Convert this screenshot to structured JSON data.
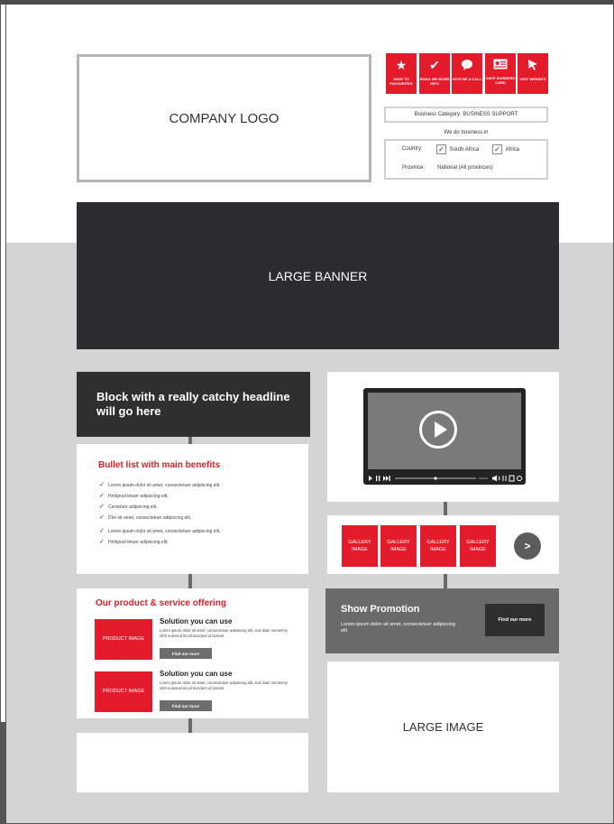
{
  "logo": "COMPANY LOGO",
  "actions": [
    {
      "label": "SAVE TO FAVOURITES",
      "icon": "star-icon"
    },
    {
      "label": "EMAIL ME MORE INFO",
      "icon": "checkmark-icon"
    },
    {
      "label": "GIVE ME A CALL",
      "icon": "speech-bubble-icon"
    },
    {
      "label": "SAVE BUSINESS CARD",
      "icon": "business-card-icon"
    },
    {
      "label": "VISIT WEBSITE",
      "icon": "cursor-icon"
    }
  ],
  "business_category": "Business Category: BUSINESS SUPPORT",
  "we_do_business": "We do business in",
  "country": {
    "label": "Country:",
    "options": [
      "South Africa",
      "Africa"
    ]
  },
  "province": {
    "label": "Province:",
    "value": "National (All provinces)"
  },
  "banner": "LARGE BANNER",
  "headline": "Block with a really catchy headline will go here",
  "bullets": {
    "title": "Bullet list with main benefits",
    "items": [
      "Lorem ipsum dolor sit amet, consectetuer adipiscing elit,",
      "Hmbjnsd tetuer adipiscing elit,",
      "Cectetuer adipiscing elit,",
      "Dlor sit amet, consectetuer adipiscing elit,",
      "Lorem ipsum dolor sit amet, consectetuer adipiscing elit,",
      "Hmbjnsd tetuer adipiscing elit,"
    ]
  },
  "products": {
    "title": "Our product & service offering",
    "items": [
      {
        "image": "PRODUCT IMAGE",
        "title": "Solution you can use",
        "desc": "Lorem ipsum dolor sit amet, consectetuer adipiscing elit, sed diam nonummy nibh euismod tincid tincidunt ut laoreet .",
        "button": "Find our more"
      },
      {
        "image": "PRODUCT IMAGE",
        "title": "Solution you can use",
        "desc": "Lorem ipsum dolor sit amet, consectetuer adipiscing elit, sed diam nonummy nibh euismod tincid tincidunt ut laoreet .",
        "button": "Find our more"
      }
    ]
  },
  "gallery": {
    "items": [
      "GALLERY IMAGE",
      "GALLERY IMAGE",
      "GALLERY IMAGE",
      "GALLERY IMAGE"
    ],
    "next": ">"
  },
  "promotion": {
    "title": "Show Promotion",
    "desc": "Lorem ipsum dolor sit amet, consectetuer adipiscing elit",
    "button": "Find our more"
  },
  "large_image": "LARGE IMAGE",
  "colors": {
    "accent_red": "#e31b2b",
    "dark": "#2c2b30",
    "grey_bg": "#d4d4d4"
  }
}
